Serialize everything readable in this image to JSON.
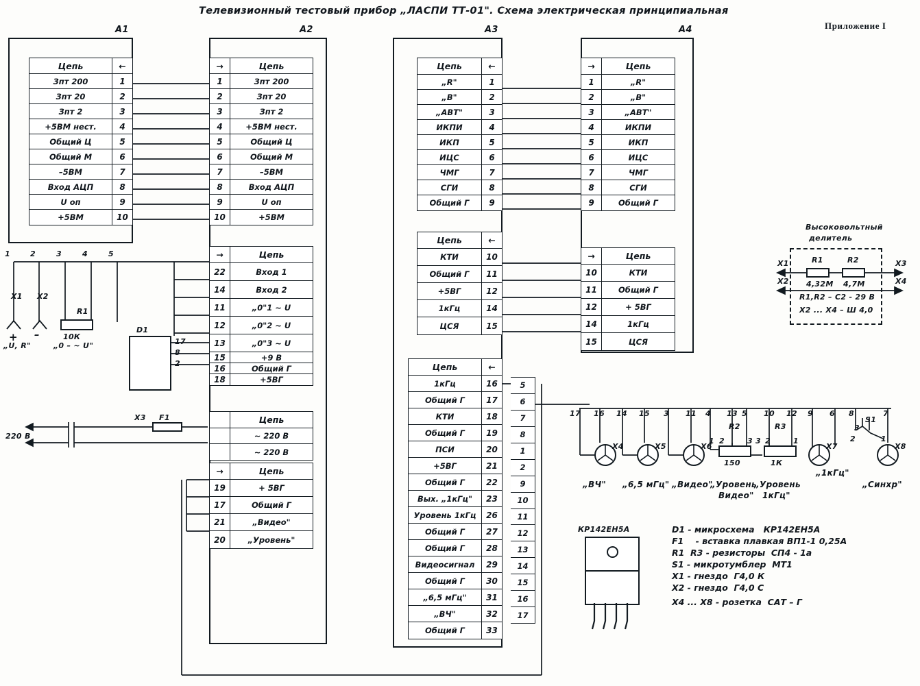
{
  "sheet": {
    "title": "Телевизионный  тестовый  прибор „ЛАСПИ ТТ-01\". Схема  электрическая  принципиальная",
    "appendix": "Приложение I"
  },
  "blocks": {
    "a1": "А1",
    "a2": "А2",
    "a3": "А3",
    "a4": "А4"
  },
  "headers": {
    "chain": "Цепь",
    "arrow_left": "←",
    "arrow_right": "→"
  },
  "tables": {
    "a1_main": {
      "header": "Цепь",
      "rows": [
        {
          "name": "Зпт 200",
          "pin": "1"
        },
        {
          "name": "Зпт 20",
          "pin": "2"
        },
        {
          "name": "Зпт 2",
          "pin": "3"
        },
        {
          "name": "+5ВМ нест.",
          "pin": "4"
        },
        {
          "name": "Общий Ц",
          "pin": "5"
        },
        {
          "name": "Общий М",
          "pin": "6"
        },
        {
          "name": "–5ВМ",
          "pin": "7"
        },
        {
          "name": "Вход АЦП",
          "pin": "8"
        },
        {
          "name": "U оп",
          "pin": "9"
        },
        {
          "name": "+5ВМ",
          "pin": "10"
        }
      ]
    },
    "a2_main": {
      "header": "Цепь",
      "rows": [
        {
          "pin": "1",
          "name": "Зпт 200"
        },
        {
          "pin": "2",
          "name": "Зпт 20"
        },
        {
          "pin": "3",
          "name": "Зпт 2"
        },
        {
          "pin": "4",
          "name": "+5ВМ нест."
        },
        {
          "pin": "5",
          "name": "Общий Ц"
        },
        {
          "pin": "6",
          "name": "Общий М"
        },
        {
          "pin": "7",
          "name": "–5ВМ"
        },
        {
          "pin": "8",
          "name": "Вход АЦП"
        },
        {
          "pin": "9",
          "name": "U оп"
        },
        {
          "pin": "10",
          "name": "+5ВМ"
        }
      ]
    },
    "a2_second": {
      "header": "Цепь",
      "rows": [
        {
          "pin": "22",
          "name": "Вход 1"
        },
        {
          "pin": "14",
          "name": "Вход 2"
        },
        {
          "pin": "11",
          "name": "„0\"1 ~ U"
        },
        {
          "pin": "12",
          "name": "„0\"2 ~ U"
        },
        {
          "pin": "13",
          "name": "„0\"3 ~ U"
        },
        {
          "pin": "15",
          "name": "+9 В"
        },
        {
          "pin": "16",
          "name": "Общий Г"
        },
        {
          "pin": "18",
          "name": "+5ВГ"
        }
      ]
    },
    "a2_mains": {
      "header": "Цепь",
      "rows": [
        {
          "pin": "",
          "name": "~ 220 В"
        },
        {
          "pin": "",
          "name": "~ 220 В"
        }
      ]
    },
    "a2_fourth": {
      "header": "Цепь",
      "rows": [
        {
          "pin": "19",
          "name": "+ 5ВГ"
        },
        {
          "pin": "17",
          "name": "Общий Г"
        },
        {
          "pin": "21",
          "name": "„Видео\""
        },
        {
          "pin": "20",
          "name": "„Уровень\""
        }
      ]
    },
    "a3_main": {
      "header": "Цепь",
      "rows": [
        {
          "name": "„R\"",
          "pin": "1"
        },
        {
          "name": "„В\"",
          "pin": "2"
        },
        {
          "name": "„АВТ\"",
          "pin": "3"
        },
        {
          "name": "ИКПИ",
          "pin": "4"
        },
        {
          "name": "ИКП",
          "pin": "5"
        },
        {
          "name": "ИЦС",
          "pin": "6"
        },
        {
          "name": "ЧМГ",
          "pin": "7"
        },
        {
          "name": "СГИ",
          "pin": "8"
        },
        {
          "name": "Общий Г",
          "pin": "9"
        }
      ]
    },
    "a3_second": {
      "header": "Цепь",
      "rows": [
        {
          "name": "КТИ",
          "pin": "10"
        },
        {
          "name": "Общий Г",
          "pin": "11"
        },
        {
          "name": "+5ВГ",
          "pin": "12"
        },
        {
          "name": "1кГц",
          "pin": "14"
        },
        {
          "name": "ЦСЯ",
          "pin": "15"
        }
      ]
    },
    "a3_third": {
      "header": "Цепь",
      "rows": [
        {
          "name": "1кГц",
          "pin": "16"
        },
        {
          "name": "Общий Г",
          "pin": "17"
        },
        {
          "name": "КТИ",
          "pin": "18"
        },
        {
          "name": "Общий Г",
          "pin": "19"
        },
        {
          "name": "ПСИ",
          "pin": "20"
        },
        {
          "name": "+5ВГ",
          "pin": "21"
        },
        {
          "name": "Общий Г",
          "pin": "22"
        },
        {
          "name": "Вых. „1кГц\"",
          "pin": "23"
        },
        {
          "name": "Уровень 1кГц",
          "pin": "26"
        },
        {
          "name": "Общий Г",
          "pin": "27"
        },
        {
          "name": "Общий Г",
          "pin": "28"
        },
        {
          "name": "Видеосигнал",
          "pin": "29"
        },
        {
          "name": "Общий Г",
          "pin": "30"
        },
        {
          "name": "„6,5 мГц\"",
          "pin": "31"
        },
        {
          "name": "„ВЧ\"",
          "pin": "32"
        },
        {
          "name": "Общий Г",
          "pin": "33"
        }
      ]
    },
    "a4_main": {
      "header": "Цепь",
      "rows": [
        {
          "pin": "1",
          "name": "„R\""
        },
        {
          "pin": "2",
          "name": "„В\""
        },
        {
          "pin": "3",
          "name": "„АВТ\""
        },
        {
          "pin": "4",
          "name": "ИКПИ"
        },
        {
          "pin": "5",
          "name": "ИКП"
        },
        {
          "pin": "6",
          "name": "ИЦС"
        },
        {
          "pin": "7",
          "name": "ЧМГ"
        },
        {
          "pin": "8",
          "name": "СГИ"
        },
        {
          "pin": "9",
          "name": "Общий Г"
        }
      ]
    },
    "a4_second": {
      "header": "Цепь",
      "rows": [
        {
          "pin": "10",
          "name": "КТИ"
        },
        {
          "pin": "11",
          "name": "Общий Г"
        },
        {
          "pin": "12",
          "name": "+ 5ВГ"
        },
        {
          "pin": "14",
          "name": "1кГц"
        },
        {
          "pin": "15",
          "name": "ЦСЯ"
        }
      ]
    }
  },
  "ladder": {
    "pins": [
      "5",
      "6",
      "7",
      "8",
      "1",
      "2",
      "9",
      "10",
      "11",
      "12",
      "13",
      "14",
      "15",
      "16",
      "17"
    ]
  },
  "left_input": {
    "pins": [
      "1",
      "2",
      "3",
      "4",
      "5"
    ],
    "x1": "X1",
    "x2": "X2",
    "plus": "+",
    "minus": "–",
    "label_ur": "„U, R\"",
    "label_0u": "„0 – ~ U\"",
    "r1_ref": "R1",
    "r1_val": "10К",
    "d1_ref": "D1",
    "d1_pins": [
      "17",
      "8",
      "2"
    ]
  },
  "mains": {
    "x3": "X3",
    "f1": "F1",
    "voltage": "220 В"
  },
  "divider": {
    "title_line1": "Высоковольтный",
    "title_line2": "делитель",
    "r1_ref": "R1",
    "r1_val": "4,32М",
    "r2_ref": "R2",
    "r2_val": "4,7М",
    "x1": "X1",
    "x2": "X2",
    "x3": "X3",
    "x4": "X4",
    "note1": "R1,R2  –  С2 - 29 В",
    "note2": "X2 ... X4  –  Ш 4,0"
  },
  "panel": {
    "top_pins": [
      "17",
      "16",
      "14",
      "15",
      "3",
      "11",
      "4",
      "13",
      "5",
      "10",
      "12",
      "9",
      "6",
      "8",
      "7"
    ],
    "jacks": [
      {
        "ref": "X4",
        "label": "„ВЧ\""
      },
      {
        "ref": "X5",
        "label": "„6,5 мГц\""
      },
      {
        "ref": "X6",
        "label": "„Видео\""
      },
      {
        "ref": "X7",
        "label": "„1кГц\""
      },
      {
        "ref": "X8",
        "label": "„Синхр\""
      }
    ],
    "r2_ref": "R2",
    "r2_val": "150",
    "r2_pins": [
      "1",
      "2",
      "3"
    ],
    "r2_label_l1": "„Уровень",
    "r2_label_l2": "Видео\"",
    "r3_ref": "R3",
    "r3_val": "1К",
    "r3_pins": [
      "3",
      "2",
      "1"
    ],
    "r3_label_l1": "„Уровень",
    "r3_label_l2": "1кГц\"",
    "s1_ref": "S1",
    "s1_pins": [
      "3",
      "2",
      "1"
    ]
  },
  "ic": {
    "ref": "КР142ЕН5А"
  },
  "legend": {
    "lines": [
      "D1 - микросхема   КР142ЕН5А",
      "F1    - вставка плавкая ВП1-1 0,25А",
      "R1  R3 - резисторы  СП4 - 1а",
      "S1 - микротумблер  МТ1",
      "X1 - гнездо  Г4,0 К",
      "X2 - гнездо  Г4,0 С",
      "X4 ... X8 - розетка  САТ – Г"
    ]
  }
}
